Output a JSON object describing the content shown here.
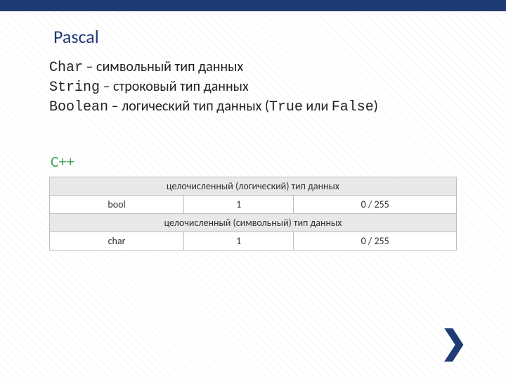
{
  "pascal": {
    "heading": "Pascal",
    "lines": [
      {
        "type": "Char",
        "desc": " – символьный тип данных"
      },
      {
        "type": "String",
        "desc": " – строковый тип данных"
      },
      {
        "type": "Boolean",
        "desc_prefix": " – логический тип данных (",
        "true": "True",
        "mid": " или ",
        "false": "False",
        "suffix": ")"
      }
    ]
  },
  "cpp": {
    "heading": "C++",
    "table": {
      "sections": [
        {
          "title": "целочисленный (логический) тип данных",
          "rows": [
            {
              "name": "bool",
              "size": "1",
              "range": "0   /   255"
            }
          ]
        },
        {
          "title": "целочисленный (символьный) тип данных",
          "rows": [
            {
              "name": "char",
              "size": "1",
              "range": "0   /   255"
            }
          ]
        }
      ]
    }
  },
  "nav": {
    "next_glyph": "❯"
  }
}
